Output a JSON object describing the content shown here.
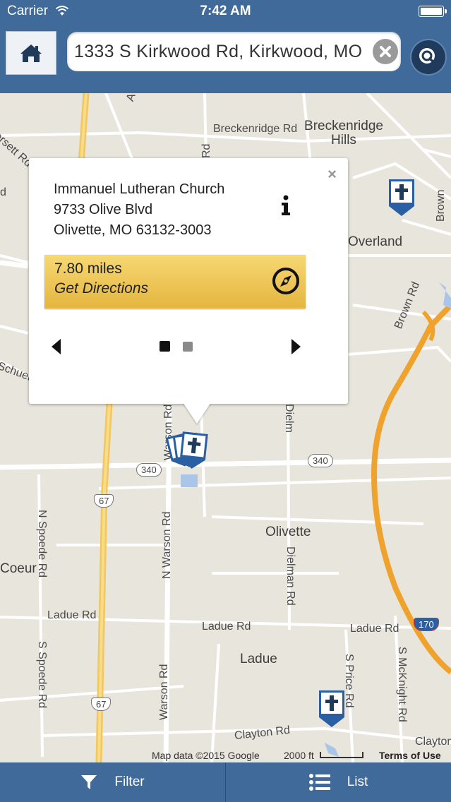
{
  "status_bar": {
    "carrier": "Carrier",
    "time": "7:42 AM"
  },
  "header": {
    "home_icon": "home-icon",
    "search": {
      "value": "1333 S Kirkwood Rd, Kirkwood, MO",
      "clear_icon": "clear-icon",
      "search_icon": "search-icon"
    }
  },
  "map": {
    "labels": {
      "breckenridge_rd": "Breckenridge Rd",
      "breckenridge_hills": "Breckenridge Hills",
      "overland": "Overland",
      "brown_rd": "Brown Rd",
      "olivette": "Olivette",
      "ladue_rd_left": "Ladue Rd",
      "ladue_rd_mid": "Ladue Rd",
      "ladue_rd_right": "Ladue Rd",
      "ladue": "Ladue",
      "n_warson_rd": "N Warson Rd",
      "warson_rd_top": "Warson Rd",
      "warson_rd_bottom": "Warson Rd",
      "dielman_rd": "Dielman Rd",
      "dielm": "Dielm",
      "n_spoede_rd": "N Spoede Rd",
      "s_spoede_rd": "S Spoede Rd",
      "s_price_rd": "S Price Rd",
      "s_mcknight_rd": "S McKnight Rd",
      "clayton_rd": "Clayton Rd",
      "clayton_right": "Clayton",
      "coeur": "Coeur",
      "schuetz": "Schuetz",
      "orsett": "orsett Rd",
      "rd_frag": "Rd",
      "brown_frag": "Brown",
      "a_frag": "A",
      "d_frag": "d",
      "shield_340_left": "340",
      "shield_340_right": "340",
      "shield_67_mid": "67",
      "shield_67_bottom": "67",
      "shield_170": "170"
    },
    "attribution": "Map data ©2015 Google",
    "scale": "2000 ft",
    "terms": "Terms of Use"
  },
  "popup": {
    "name": "Immanuel Lutheran Church",
    "street": "9733 Olive Blvd",
    "city": "Olivette, MO 63132-3003",
    "distance": "7.80 miles",
    "directions_label": "Get Directions",
    "close_glyph": "×",
    "page_count": 2,
    "active_page": 1
  },
  "tabbar": {
    "filter_label": "Filter",
    "list_label": "List"
  },
  "colors": {
    "bar": "#3f6a99",
    "directions": "#f0c85a",
    "highway": "#f5a623",
    "pin": "#2b5fa3"
  }
}
